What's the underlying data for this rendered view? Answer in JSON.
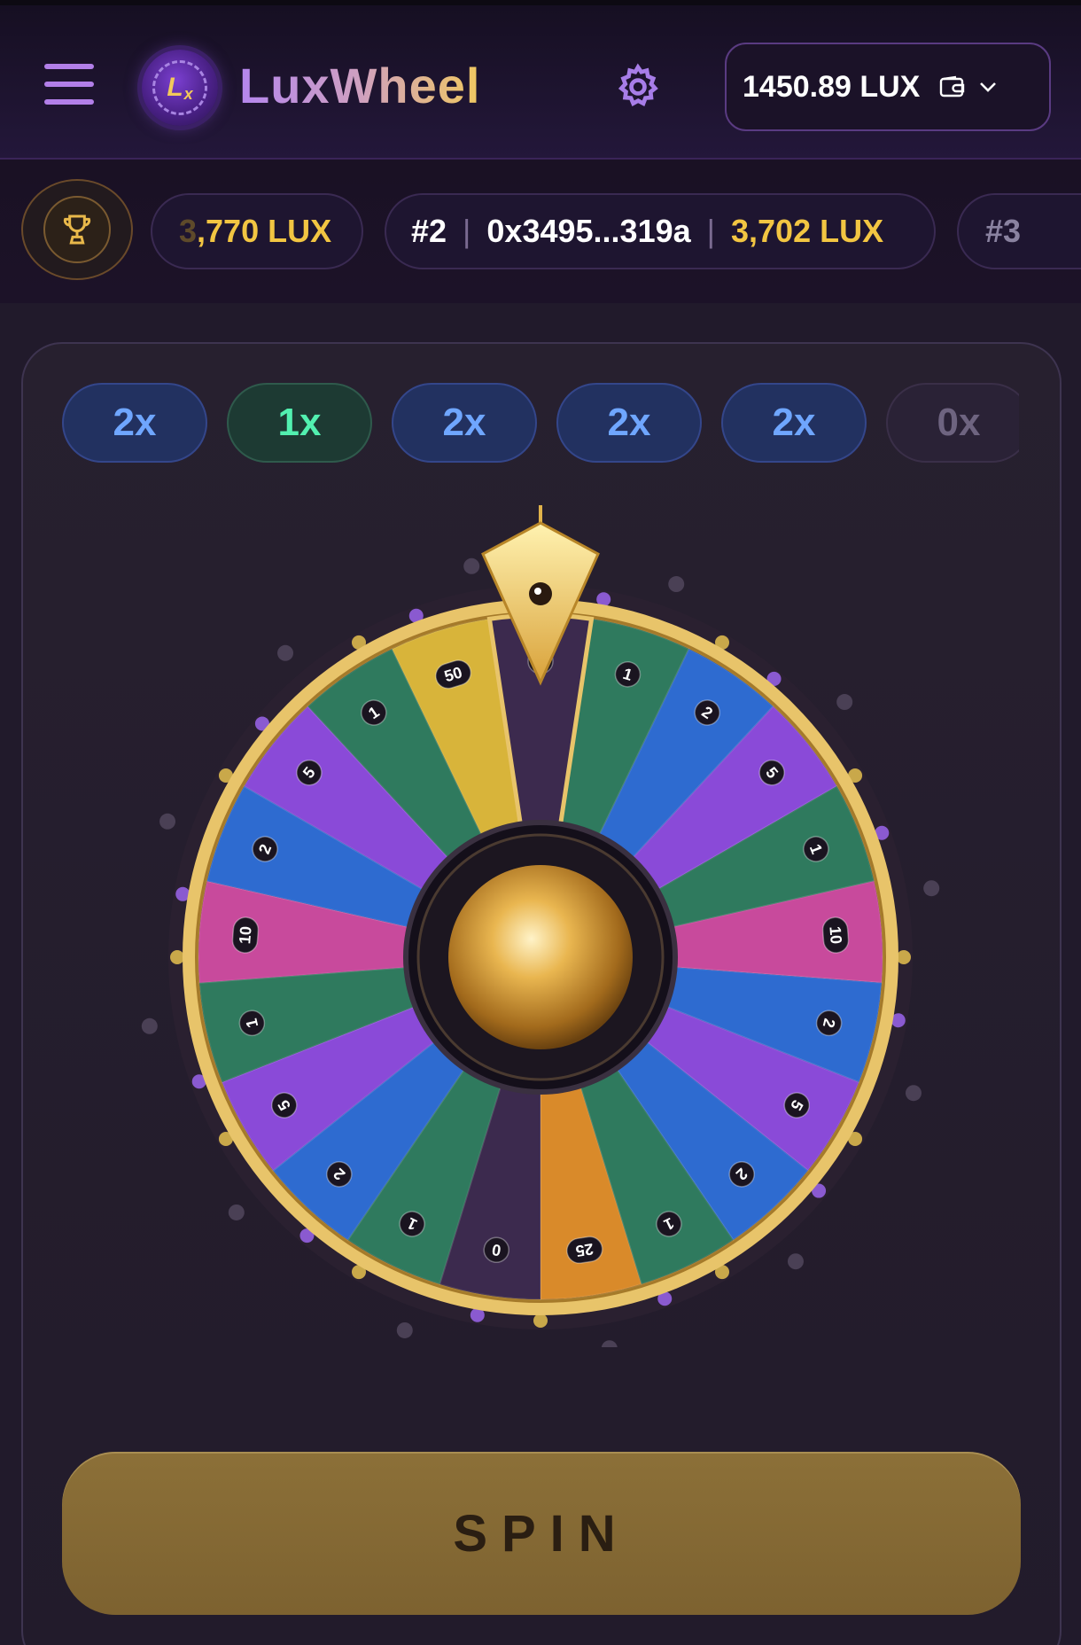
{
  "header": {
    "brand": "LuxWheel",
    "logo_text": "L",
    "logo_sub": "x",
    "balance": "1450.89 LUX"
  },
  "leaderboard": [
    {
      "rank": "",
      "address": "",
      "amount": ",770 LUX",
      "amount_prefix": "3"
    },
    {
      "rank": "#2",
      "address": "0x3495...319a",
      "amount": "3,702 LUX"
    },
    {
      "rank": "#3",
      "address": "",
      "amount": ""
    }
  ],
  "history": [
    "2x",
    "1x",
    "2x",
    "2x",
    "2x",
    "0x"
  ],
  "wheel": {
    "segments": [
      "0",
      "1",
      "2",
      "5",
      "1",
      "10",
      "2",
      "5",
      "2",
      "1",
      "25",
      "0",
      "1",
      "2",
      "5",
      "1",
      "10",
      "2",
      "5",
      "1",
      "50"
    ],
    "colors": {
      "0": "#3c2a4e",
      "1": "#2f7a5e",
      "2": "#2e6bd0",
      "5": "#8a4ad8",
      "10": "#c84a9c",
      "25": "#d98a2a",
      "50": "#d8b43a"
    },
    "rim_color": "#e8c46a"
  },
  "spin_label": "SPIN"
}
